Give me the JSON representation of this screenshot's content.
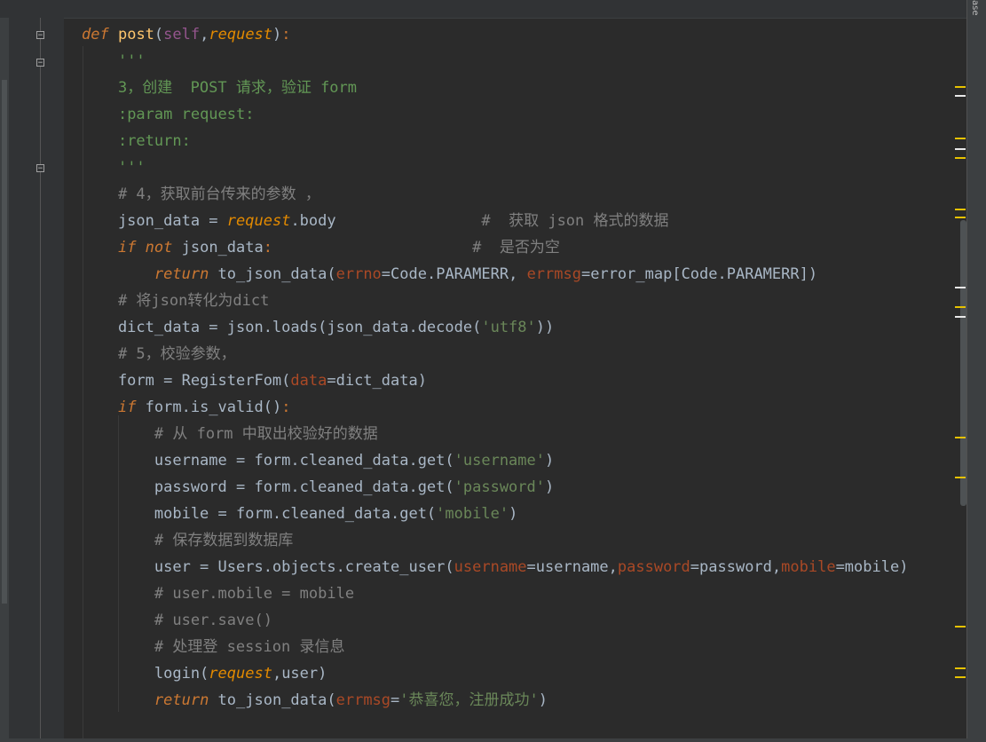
{
  "side_panel_label": "ase",
  "code_lines": [
    [
      [
        "kw",
        "def"
      ],
      [
        "op",
        " "
      ],
      [
        "fn",
        "post"
      ],
      [
        "op",
        "("
      ],
      [
        "slf",
        "self"
      ],
      [
        "op",
        ","
      ],
      [
        "prm",
        "request"
      ],
      [
        "op",
        ")"
      ],
      [
        "pn",
        ":"
      ]
    ],
    [
      [
        "op",
        "    "
      ],
      [
        "ds",
        "'''"
      ]
    ],
    [
      [
        "op",
        "    "
      ],
      [
        "ds",
        "3，创建  POST 请求，验证 form"
      ]
    ],
    [
      [
        "op",
        "    "
      ],
      [
        "ds",
        ":param request:"
      ]
    ],
    [
      [
        "op",
        "    "
      ],
      [
        "ds",
        ":return:"
      ]
    ],
    [
      [
        "op",
        "    "
      ],
      [
        "ds",
        "'''"
      ]
    ],
    [
      [
        "op",
        "    "
      ],
      [
        "cm",
        "# 4，获取前台传来的参数 ，"
      ]
    ],
    [
      [
        "op",
        "    json_data "
      ],
      [
        "op",
        "= "
      ],
      [
        "prm",
        "request"
      ],
      [
        "op",
        ".body"
      ],
      [
        "op",
        "                "
      ],
      [
        "cm",
        "#  获取 json 格式的数据"
      ]
    ],
    [
      [
        "op",
        "    "
      ],
      [
        "kw",
        "if not"
      ],
      [
        "op",
        " json_data"
      ],
      [
        "pn",
        ":"
      ],
      [
        "op",
        "                      "
      ],
      [
        "cm",
        "#  是否为空"
      ]
    ],
    [
      [
        "op",
        "        "
      ],
      [
        "kw",
        "return"
      ],
      [
        "op",
        " to_json_data("
      ],
      [
        "kwarg",
        "errno"
      ],
      [
        "op",
        "=Code.PARAMERR, "
      ],
      [
        "kwarg",
        "errmsg"
      ],
      [
        "op",
        "=error_map[Code.PARAMERR])"
      ]
    ],
    [
      [
        "op",
        "    "
      ],
      [
        "cm",
        "# 将json转化为dict"
      ]
    ],
    [
      [
        "op",
        "    dict_data = json.loads(json_data.decode("
      ],
      [
        "str",
        "'utf8'"
      ],
      [
        "op",
        "))"
      ]
    ],
    [
      [
        "op",
        "    "
      ],
      [
        "cm",
        "# 5，校验参数，"
      ]
    ],
    [
      [
        "op",
        "    form = RegisterFom("
      ],
      [
        "kwarg",
        "data"
      ],
      [
        "op",
        "=dict_data)"
      ]
    ],
    [
      [
        "op",
        "    "
      ],
      [
        "kw",
        "if"
      ],
      [
        "op",
        " form.is_valid()"
      ],
      [
        "pn",
        ":"
      ]
    ],
    [
      [
        "op",
        "        "
      ],
      [
        "cm",
        "# 从 form 中取出校验好的数据"
      ]
    ],
    [
      [
        "op",
        "        username = form.cleaned_data.get("
      ],
      [
        "str",
        "'username'"
      ],
      [
        "op",
        ")"
      ]
    ],
    [
      [
        "op",
        "        password = form.cleaned_data.get("
      ],
      [
        "str",
        "'password'"
      ],
      [
        "op",
        ")"
      ]
    ],
    [
      [
        "op",
        "        mobile = form.cleaned_data.get("
      ],
      [
        "str",
        "'mobile'"
      ],
      [
        "op",
        ")"
      ]
    ],
    [
      [
        "op",
        "        "
      ],
      [
        "cm",
        "# 保存数据到数据库"
      ]
    ],
    [
      [
        "op",
        "        user = Users.objects.create_user("
      ],
      [
        "kwarg",
        "username"
      ],
      [
        "op",
        "=username,"
      ],
      [
        "kwarg",
        "password"
      ],
      [
        "op",
        "=password,"
      ],
      [
        "kwarg",
        "mobile"
      ],
      [
        "op",
        "=mobile)"
      ]
    ],
    [
      [
        "op",
        "        "
      ],
      [
        "cm",
        "# user.mobile = mobile"
      ]
    ],
    [
      [
        "op",
        "        "
      ],
      [
        "cm",
        "# user.save()"
      ]
    ],
    [
      [
        "op",
        "        "
      ],
      [
        "cm",
        "# 处理登 session 录信息"
      ]
    ],
    [
      [
        "op",
        "        login("
      ],
      [
        "prm",
        "request"
      ],
      [
        "op",
        ",user)"
      ]
    ],
    [
      [
        "op",
        "        "
      ],
      [
        "kw",
        "return"
      ],
      [
        "op",
        " to_json_data("
      ],
      [
        "kwarg",
        "errmsg"
      ],
      [
        "op",
        "="
      ],
      [
        "str",
        "'恭喜您，注册成功'"
      ],
      [
        "op",
        ")"
      ]
    ]
  ]
}
